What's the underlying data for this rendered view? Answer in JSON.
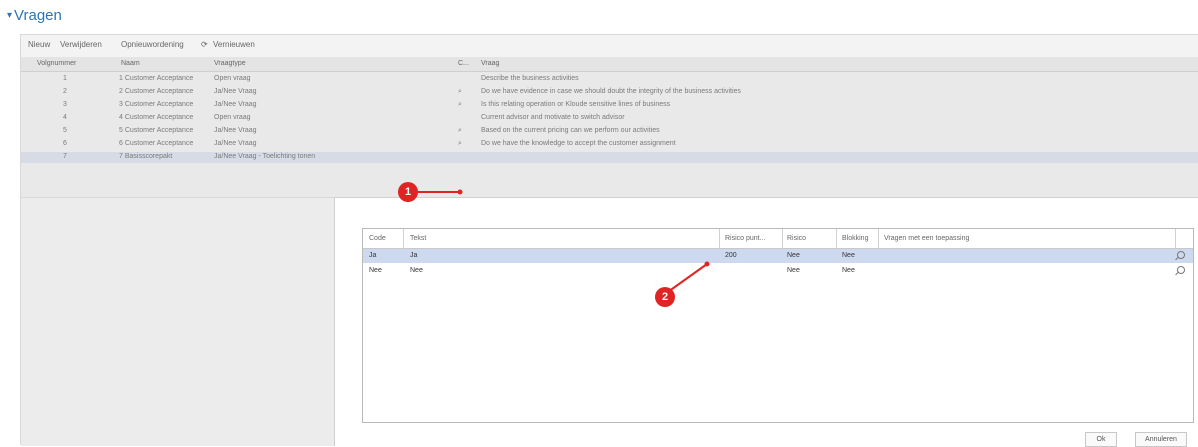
{
  "page": {
    "title": "Vragen"
  },
  "toolbar": {
    "items": [
      "Nieuw",
      "Verwijderen",
      "Opnieuwordening",
      "Vernieuwen"
    ]
  },
  "grid": {
    "headers": [
      "Volgnummer",
      "Naam",
      "Vraagtype",
      "C...",
      "Vraag"
    ],
    "rows": [
      {
        "nr": "1",
        "naam": "1 Customer Acceptance",
        "type": "Open vraag",
        "c": "",
        "vraag": "Describe the business activities"
      },
      {
        "nr": "2",
        "naam": "2 Customer Acceptance",
        "type": "Ja/Nee Vraag",
        "c": "⌕",
        "vraag": "Do we have evidence in case we should doubt the integrity of the business activities"
      },
      {
        "nr": "3",
        "naam": "3 Customer Acceptance",
        "type": "Ja/Nee Vraag",
        "c": "⌕",
        "vraag": "Is this relating operation or Kloude sensitive lines of business"
      },
      {
        "nr": "4",
        "naam": "4 Customer Acceptance",
        "type": "Open vraag",
        "c": "",
        "vraag": "Current advisor and motivate to switch advisor"
      },
      {
        "nr": "5",
        "naam": "5 Customer Acceptance",
        "type": "Ja/Nee Vraag",
        "c": "⌕",
        "vraag": "Based on the current pricing can we perform our activities"
      },
      {
        "nr": "6",
        "naam": "6 Customer Acceptance",
        "type": "Ja/Nee Vraag",
        "c": "⌕",
        "vraag": "Do we have the knowledge to accept the customer assignment"
      },
      {
        "nr": "7",
        "naam": "7 Basisscorepakt",
        "type": "Ja/Nee Vraag - Toelichting tonen",
        "c": "",
        "vraag": ""
      }
    ]
  },
  "dialog": {
    "headers": [
      "Code",
      "Tekst",
      "Risico punt...",
      "Risico",
      "Blokking",
      "Vragen met een toepassing"
    ],
    "rows": [
      {
        "code": "Ja",
        "tekst": "Ja",
        "risico_punt": "200",
        "risico": "Nee",
        "blokking": "Nee",
        "vragen": ""
      },
      {
        "code": "Nee",
        "tekst": "Nee",
        "risico_punt": "",
        "risico": "Nee",
        "blokking": "Nee",
        "vragen": ""
      }
    ],
    "ok_label": "Ok",
    "cancel_label": "Annuleren"
  },
  "annotations": {
    "badge1": "1",
    "badge2": "2"
  },
  "colors": {
    "accent": "#2e75b6",
    "badge": "#e02424",
    "selected_row": "#cdd9ef"
  }
}
